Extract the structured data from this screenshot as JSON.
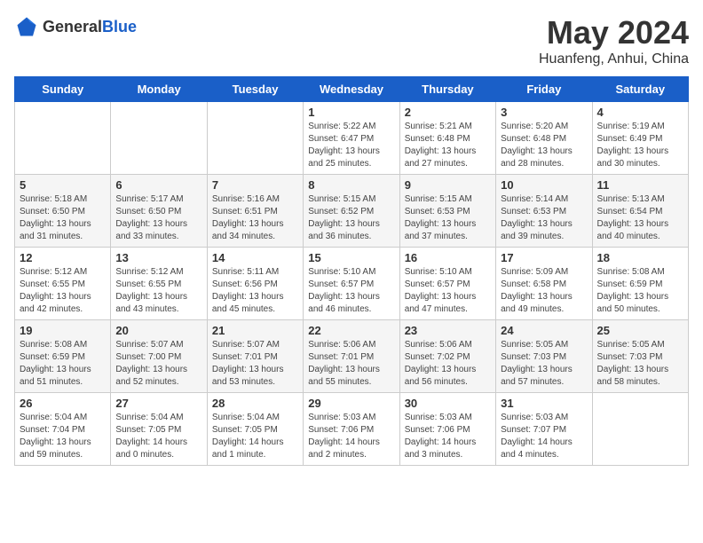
{
  "logo": {
    "text_general": "General",
    "text_blue": "Blue"
  },
  "title": "May 2024",
  "subtitle": "Huanfeng, Anhui, China",
  "days_of_week": [
    "Sunday",
    "Monday",
    "Tuesday",
    "Wednesday",
    "Thursday",
    "Friday",
    "Saturday"
  ],
  "weeks": [
    [
      {
        "day": "",
        "info": ""
      },
      {
        "day": "",
        "info": ""
      },
      {
        "day": "",
        "info": ""
      },
      {
        "day": "1",
        "info": "Sunrise: 5:22 AM\nSunset: 6:47 PM\nDaylight: 13 hours and 25 minutes."
      },
      {
        "day": "2",
        "info": "Sunrise: 5:21 AM\nSunset: 6:48 PM\nDaylight: 13 hours and 27 minutes."
      },
      {
        "day": "3",
        "info": "Sunrise: 5:20 AM\nSunset: 6:48 PM\nDaylight: 13 hours and 28 minutes."
      },
      {
        "day": "4",
        "info": "Sunrise: 5:19 AM\nSunset: 6:49 PM\nDaylight: 13 hours and 30 minutes."
      }
    ],
    [
      {
        "day": "5",
        "info": "Sunrise: 5:18 AM\nSunset: 6:50 PM\nDaylight: 13 hours and 31 minutes."
      },
      {
        "day": "6",
        "info": "Sunrise: 5:17 AM\nSunset: 6:50 PM\nDaylight: 13 hours and 33 minutes."
      },
      {
        "day": "7",
        "info": "Sunrise: 5:16 AM\nSunset: 6:51 PM\nDaylight: 13 hours and 34 minutes."
      },
      {
        "day": "8",
        "info": "Sunrise: 5:15 AM\nSunset: 6:52 PM\nDaylight: 13 hours and 36 minutes."
      },
      {
        "day": "9",
        "info": "Sunrise: 5:15 AM\nSunset: 6:53 PM\nDaylight: 13 hours and 37 minutes."
      },
      {
        "day": "10",
        "info": "Sunrise: 5:14 AM\nSunset: 6:53 PM\nDaylight: 13 hours and 39 minutes."
      },
      {
        "day": "11",
        "info": "Sunrise: 5:13 AM\nSunset: 6:54 PM\nDaylight: 13 hours and 40 minutes."
      }
    ],
    [
      {
        "day": "12",
        "info": "Sunrise: 5:12 AM\nSunset: 6:55 PM\nDaylight: 13 hours and 42 minutes."
      },
      {
        "day": "13",
        "info": "Sunrise: 5:12 AM\nSunset: 6:55 PM\nDaylight: 13 hours and 43 minutes."
      },
      {
        "day": "14",
        "info": "Sunrise: 5:11 AM\nSunset: 6:56 PM\nDaylight: 13 hours and 45 minutes."
      },
      {
        "day": "15",
        "info": "Sunrise: 5:10 AM\nSunset: 6:57 PM\nDaylight: 13 hours and 46 minutes."
      },
      {
        "day": "16",
        "info": "Sunrise: 5:10 AM\nSunset: 6:57 PM\nDaylight: 13 hours and 47 minutes."
      },
      {
        "day": "17",
        "info": "Sunrise: 5:09 AM\nSunset: 6:58 PM\nDaylight: 13 hours and 49 minutes."
      },
      {
        "day": "18",
        "info": "Sunrise: 5:08 AM\nSunset: 6:59 PM\nDaylight: 13 hours and 50 minutes."
      }
    ],
    [
      {
        "day": "19",
        "info": "Sunrise: 5:08 AM\nSunset: 6:59 PM\nDaylight: 13 hours and 51 minutes."
      },
      {
        "day": "20",
        "info": "Sunrise: 5:07 AM\nSunset: 7:00 PM\nDaylight: 13 hours and 52 minutes."
      },
      {
        "day": "21",
        "info": "Sunrise: 5:07 AM\nSunset: 7:01 PM\nDaylight: 13 hours and 53 minutes."
      },
      {
        "day": "22",
        "info": "Sunrise: 5:06 AM\nSunset: 7:01 PM\nDaylight: 13 hours and 55 minutes."
      },
      {
        "day": "23",
        "info": "Sunrise: 5:06 AM\nSunset: 7:02 PM\nDaylight: 13 hours and 56 minutes."
      },
      {
        "day": "24",
        "info": "Sunrise: 5:05 AM\nSunset: 7:03 PM\nDaylight: 13 hours and 57 minutes."
      },
      {
        "day": "25",
        "info": "Sunrise: 5:05 AM\nSunset: 7:03 PM\nDaylight: 13 hours and 58 minutes."
      }
    ],
    [
      {
        "day": "26",
        "info": "Sunrise: 5:04 AM\nSunset: 7:04 PM\nDaylight: 13 hours and 59 minutes."
      },
      {
        "day": "27",
        "info": "Sunrise: 5:04 AM\nSunset: 7:05 PM\nDaylight: 14 hours and 0 minutes."
      },
      {
        "day": "28",
        "info": "Sunrise: 5:04 AM\nSunset: 7:05 PM\nDaylight: 14 hours and 1 minute."
      },
      {
        "day": "29",
        "info": "Sunrise: 5:03 AM\nSunset: 7:06 PM\nDaylight: 14 hours and 2 minutes."
      },
      {
        "day": "30",
        "info": "Sunrise: 5:03 AM\nSunset: 7:06 PM\nDaylight: 14 hours and 3 minutes."
      },
      {
        "day": "31",
        "info": "Sunrise: 5:03 AM\nSunset: 7:07 PM\nDaylight: 14 hours and 4 minutes."
      },
      {
        "day": "",
        "info": ""
      }
    ]
  ]
}
